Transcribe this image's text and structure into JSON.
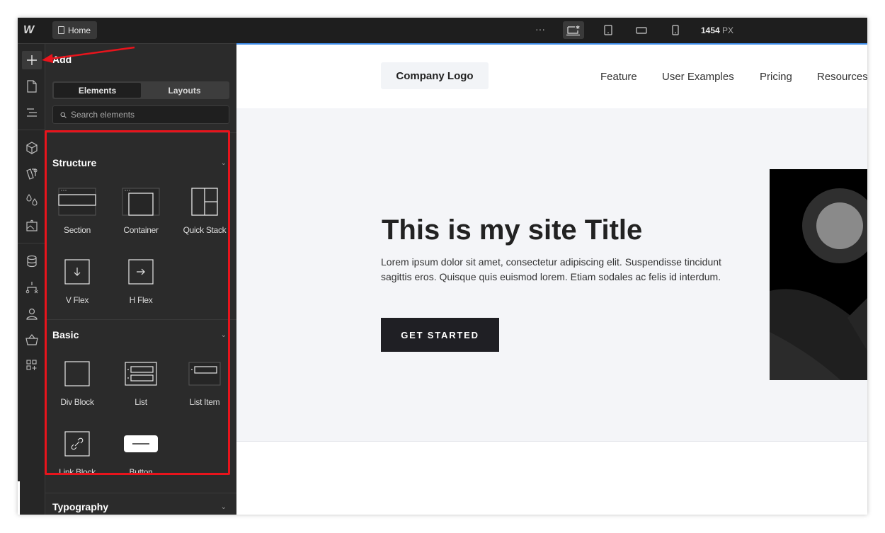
{
  "topbar": {
    "logo_text": "W",
    "page_tab": {
      "icon": "page-icon",
      "label": "Home"
    },
    "more_label": "···",
    "viewports": [
      {
        "icon": "desktop-star-icon",
        "active": true
      },
      {
        "icon": "tablet-icon",
        "active": false
      },
      {
        "icon": "mobile-landscape-icon",
        "active": false
      },
      {
        "icon": "mobile-portrait-icon",
        "active": false
      }
    ],
    "width_value": "1454",
    "width_unit": "PX",
    "accent_color": "#3c8be8"
  },
  "rail": {
    "items": [
      {
        "icon": "add-icon",
        "active": true
      },
      {
        "icon": "pages-icon"
      },
      {
        "icon": "navigator-icon"
      },
      {
        "icon": "components-icon"
      },
      {
        "icon": "style-selectors-icon"
      },
      {
        "icon": "variables-icon"
      },
      {
        "icon": "assets-icon"
      },
      {
        "icon": "cms-icon"
      },
      {
        "icon": "logic-icon"
      },
      {
        "icon": "users-icon"
      },
      {
        "icon": "ecommerce-icon"
      },
      {
        "icon": "apps-icon"
      }
    ]
  },
  "panel": {
    "title": "Add",
    "tabs": [
      {
        "label": "Elements",
        "active": true
      },
      {
        "label": "Layouts",
        "active": false
      }
    ],
    "search": {
      "placeholder": "Search elements",
      "value": ""
    },
    "sections": [
      {
        "title": "Structure",
        "items": [
          {
            "label": "Section",
            "icon": "section-icon"
          },
          {
            "label": "Container",
            "icon": "container-icon"
          },
          {
            "label": "Quick Stack",
            "icon": "quick-stack-icon"
          },
          {
            "label": "V Flex",
            "icon": "v-flex-icon"
          },
          {
            "label": "H Flex",
            "icon": "h-flex-icon"
          }
        ]
      },
      {
        "title": "Basic",
        "items": [
          {
            "label": "Div Block",
            "icon": "div-block-icon"
          },
          {
            "label": "List",
            "icon": "list-icon"
          },
          {
            "label": "List Item",
            "icon": "list-item-icon"
          },
          {
            "label": "Link Block",
            "icon": "link-block-icon"
          },
          {
            "label": "Button",
            "icon": "button-icon"
          }
        ]
      },
      {
        "title": "Typography",
        "items": []
      }
    ]
  },
  "annotation": {
    "color": "#e8141c"
  },
  "canvas": {
    "nav": {
      "logo": "Company Logo",
      "links": [
        "Feature",
        "User Examples",
        "Pricing",
        "Resources"
      ]
    },
    "hero": {
      "title": "This is my site Title",
      "body": "Lorem ipsum dolor sit amet, consectetur adipiscing elit. Suspendisse tincidunt sagittis eros. Quisque quis euismod lorem. Etiam sodales ac felis id interdum.",
      "cta": "GET STARTED",
      "image_icon": "image-placeholder-icon"
    }
  }
}
